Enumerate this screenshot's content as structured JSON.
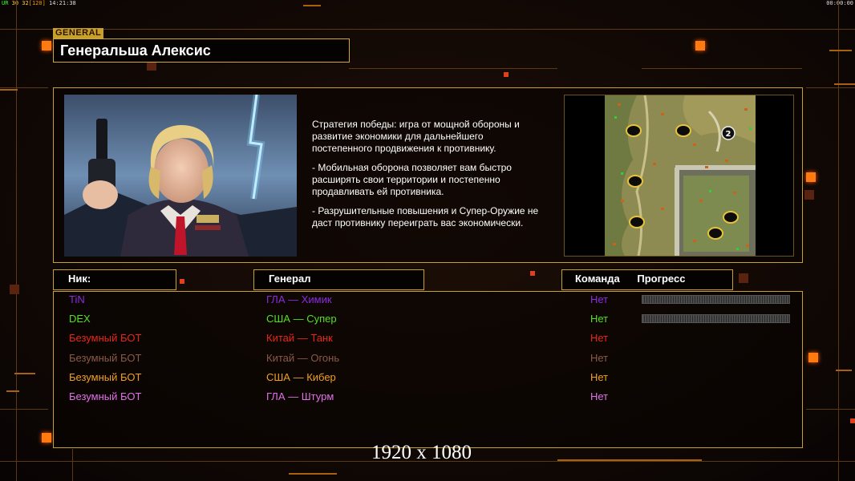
{
  "hud": {
    "left_label": "UR",
    "frame_values": "30 32",
    "bracket_value": "[120]",
    "clock_left": "14:21:38",
    "clock_right": "00:00:00"
  },
  "general_tag": "GENERAL",
  "general_name": "Генеральша Алексис",
  "strategy": [
    "Стратегия победы: игра от мощной обороны и\n развитие экономики для дальнейшего\n постепенного продвижения к противнику.",
    "- Мобильная оборона позволяет вам быстро\n расширять свои территории и постепенно\n продавливать ей противника.",
    "- Разрушительные повышения и Супер-Оружие не\n даст противнику переиграть вас экономически."
  ],
  "map": {
    "marker_label": "2"
  },
  "columns": {
    "nick": "Ник:",
    "general": "Генерал",
    "team": "Команда",
    "progress": "Прогресс"
  },
  "players": [
    {
      "nick": "TiN",
      "general": "ГЛА — Химик",
      "team": "Нет",
      "color": "#8a2be2",
      "progress": 0
    },
    {
      "nick": "DEX",
      "general": "США — Супер",
      "team": "Нет",
      "color": "#52e020",
      "progress": 0
    },
    {
      "nick": "Безумный БОТ",
      "general": "Китай — Танк",
      "team": "Нет",
      "color": "#e8261a"
    },
    {
      "nick": "Безумный БОТ",
      "general": "Китай — Огонь",
      "team": "Нет",
      "color": "#8a5a46"
    },
    {
      "nick": "Безумный БОТ",
      "general": "США — Кибер",
      "team": "Нет",
      "color": "#f0a020"
    },
    {
      "nick": "Безумный БОТ",
      "general": "ГЛА — Штурм",
      "team": "Нет",
      "color": "#e070e8"
    }
  ],
  "resolution_watermark": "1920 x 1080"
}
